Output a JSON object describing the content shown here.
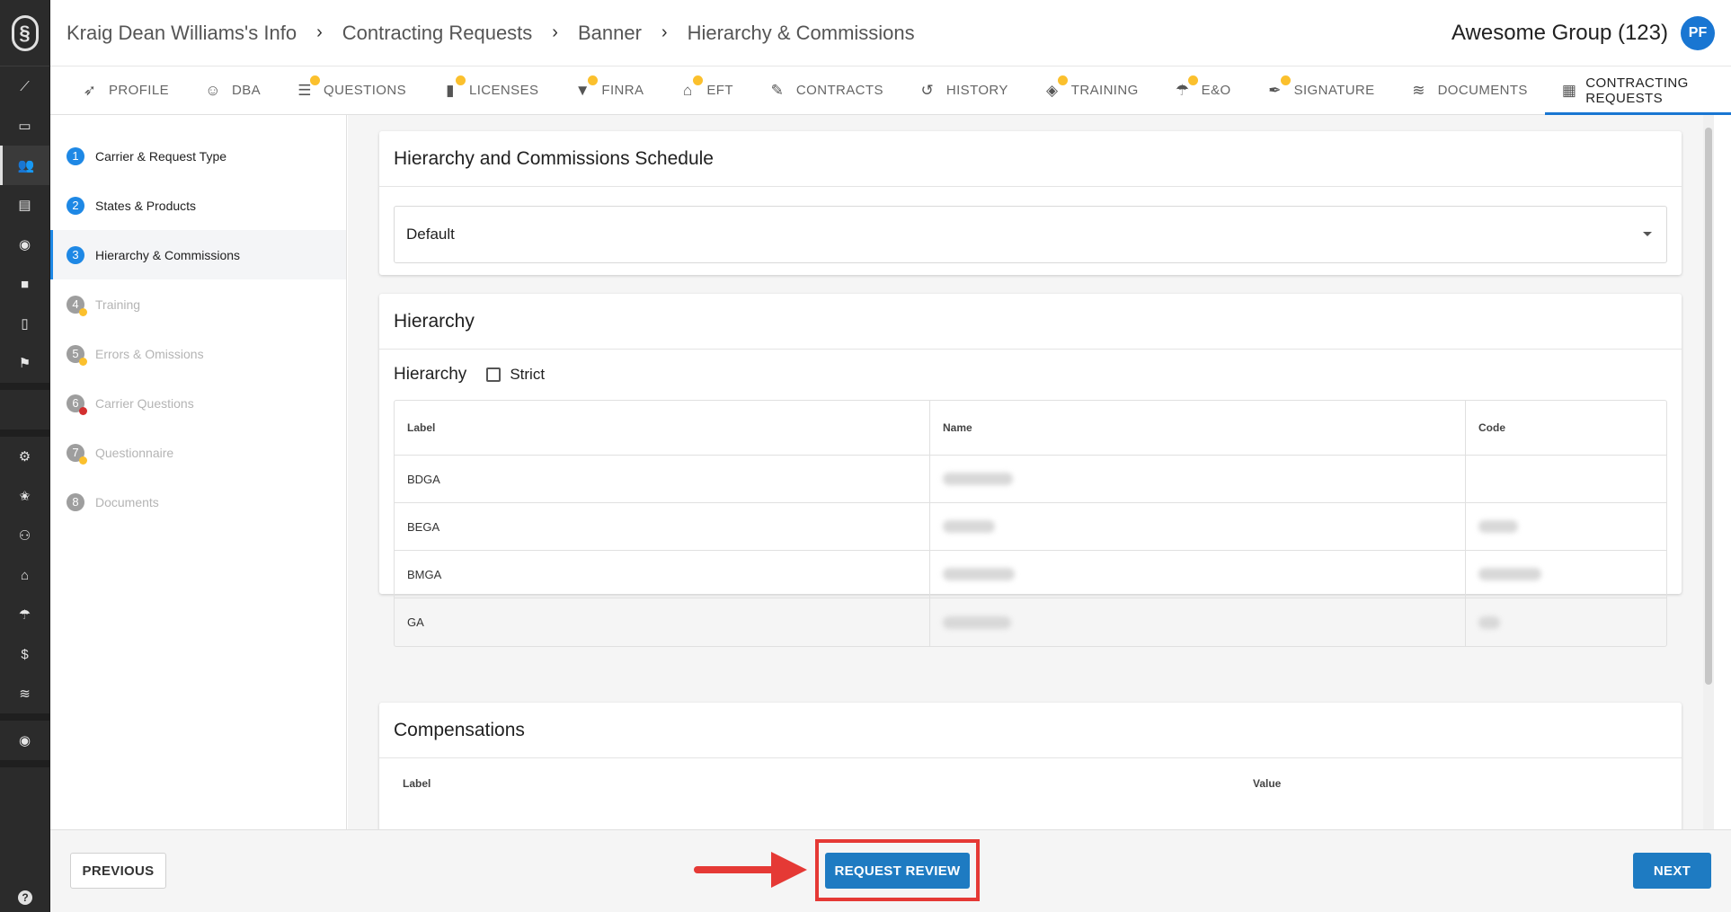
{
  "header": {
    "breadcrumbs": [
      "Kraig Dean Williams's Info",
      "Contracting Requests",
      "Banner",
      "Hierarchy & Commissions"
    ],
    "org": "Awesome Group (123)",
    "avatar_initials": "PF"
  },
  "sidebar_icons": [
    "trend-icon",
    "monitor-icon",
    "people-icon",
    "store-icon",
    "dollar-circle-icon",
    "briefcase-icon",
    "document-icon",
    "flag-icon",
    "gear-icon",
    "star-badge-icon",
    "person-settings-icon",
    "bank-icon",
    "umbrella-icon",
    "dollar-icon",
    "stack-icon",
    "dollar-circle-icon",
    "help-icon"
  ],
  "tabs": [
    {
      "label": "PROFILE",
      "icon": "feather-icon",
      "dot": false
    },
    {
      "label": "DBA",
      "icon": "mask-icon",
      "dot": false
    },
    {
      "label": "QUESTIONS",
      "icon": "list-icon",
      "dot": true
    },
    {
      "label": "LICENSES",
      "icon": "file-icon",
      "dot": true
    },
    {
      "label": "FINRA",
      "icon": "filter-icon",
      "dot": true
    },
    {
      "label": "EFT",
      "icon": "bank-icon",
      "dot": true
    },
    {
      "label": "CONTRACTS",
      "icon": "edit-list-icon",
      "dot": false
    },
    {
      "label": "HISTORY",
      "icon": "history-icon",
      "dot": false
    },
    {
      "label": "TRAINING",
      "icon": "graduation-cap-icon",
      "dot": true
    },
    {
      "label": "E&O",
      "icon": "umbrella-icon",
      "dot": true
    },
    {
      "label": "SIGNATURE",
      "icon": "pen-icon",
      "dot": true
    },
    {
      "label": "DOCUMENTS",
      "icon": "stack-icon",
      "dot": false
    },
    {
      "label": "CONTRACTING REQUESTS",
      "icon": "table-icon",
      "dot": false
    }
  ],
  "steps": [
    {
      "num": "1",
      "label": "Carrier & Request Type",
      "state": "done",
      "badge": ""
    },
    {
      "num": "2",
      "label": "States & Products",
      "state": "done",
      "badge": ""
    },
    {
      "num": "3",
      "label": "Hierarchy & Commissions",
      "state": "active",
      "badge": ""
    },
    {
      "num": "4",
      "label": "Training",
      "state": "disabled",
      "badge": "yellow"
    },
    {
      "num": "5",
      "label": "Errors & Omissions",
      "state": "disabled",
      "badge": "yellow"
    },
    {
      "num": "6",
      "label": "Carrier Questions",
      "state": "disabled",
      "badge": "red"
    },
    {
      "num": "7",
      "label": "Questionnaire",
      "state": "disabled",
      "badge": "yellow"
    },
    {
      "num": "8",
      "label": "Documents",
      "state": "disabled",
      "badge": ""
    }
  ],
  "schedule": {
    "title": "Hierarchy and Commissions Schedule",
    "selected": "Default"
  },
  "hierarchy": {
    "title": "Hierarchy",
    "sub_label": "Hierarchy",
    "strict_label": "Strict",
    "strict_checked": false,
    "columns": [
      "Label",
      "Name",
      "Code"
    ],
    "rows": [
      {
        "label": "BDGA"
      },
      {
        "label": "BEGA"
      },
      {
        "label": "BMGA"
      },
      {
        "label": "GA"
      }
    ]
  },
  "compensations": {
    "title": "Compensations",
    "columns": [
      "Label",
      "Value"
    ]
  },
  "footer": {
    "previous": "PREVIOUS",
    "request_review": "REQUEST REVIEW",
    "next": "NEXT"
  },
  "colors": {
    "primary": "#1e7bc2",
    "highlight": "#e53935",
    "badge_yellow": "#fbc02d",
    "badge_red": "#d32f2f"
  }
}
